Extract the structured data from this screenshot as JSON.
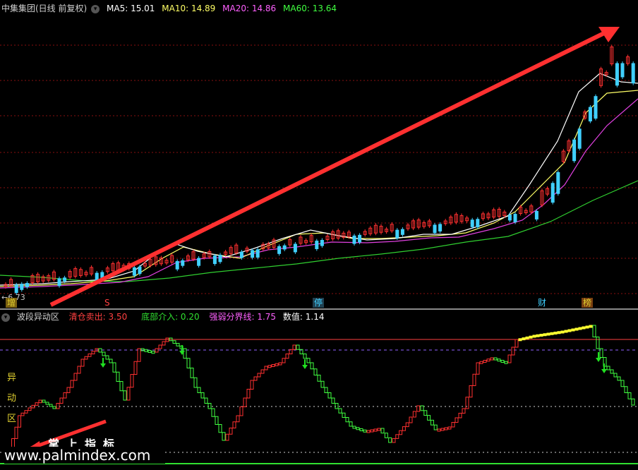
{
  "main_header": {
    "title": "中集集团(日线 前复权)",
    "ma5_label": "MA5: 15.01",
    "ma10_label": "MA10: 14.89",
    "ma20_label": "MA20: 14.86",
    "ma60_label": "MA60: 13.64"
  },
  "main_chart": {
    "low_price_label": "←6.73",
    "event_tags": [
      {
        "text": "增",
        "color": "#e0d030",
        "bg": "#7a6010"
      },
      {
        "text": "S",
        "color": "#ff4040",
        "bg": "#000000"
      },
      {
        "text": "停",
        "color": "#40d0ff",
        "bg": "#204050"
      },
      {
        "text": "财",
        "color": "#40d0ff",
        "bg": "#000000"
      },
      {
        "text": "榜",
        "color": "#e0d030",
        "bg": "#7a4010"
      }
    ],
    "ma_colors": {
      "ma5": "#ffffff",
      "ma10": "#ffff66",
      "ma20": "#e040e0",
      "ma60": "#30d030"
    },
    "candle_colors": {
      "up": "#ff3030",
      "down": "#40d0ff"
    },
    "trend_arrow_color": "#ff3030"
  },
  "sub_header": {
    "indicator_name": "波段异动区",
    "clear_label": "清仓卖出: 3.50",
    "bottom_label": "底部介入: 0.20",
    "strength_label": "强弱分界线: 1.75",
    "value_label": "数值: 1.14"
  },
  "sub_chart": {
    "side_chars": [
      "异",
      "动",
      "区"
    ],
    "colors": {
      "up": "#ff3030",
      "down": "#40ff40",
      "top": "#ffff30",
      "signal_arrow": "#20e020"
    },
    "levels": {
      "clear": 3.5,
      "bottom": 0.2,
      "strength": 1.75,
      "current": 1.14
    }
  },
  "watermark": {
    "cn": "掌上指标",
    "url": "www.palmindex.com"
  },
  "colors": {
    "grid": "#8a1010",
    "title": "#d0d0d0",
    "ma5": "#ffffff",
    "ma10": "#ffff66",
    "ma20": "#ff60ff",
    "ma60": "#40ff40",
    "clear": "#ff4040",
    "bottom": "#30e030",
    "strength": "#ff60ff",
    "value": "#ffffff"
  }
}
